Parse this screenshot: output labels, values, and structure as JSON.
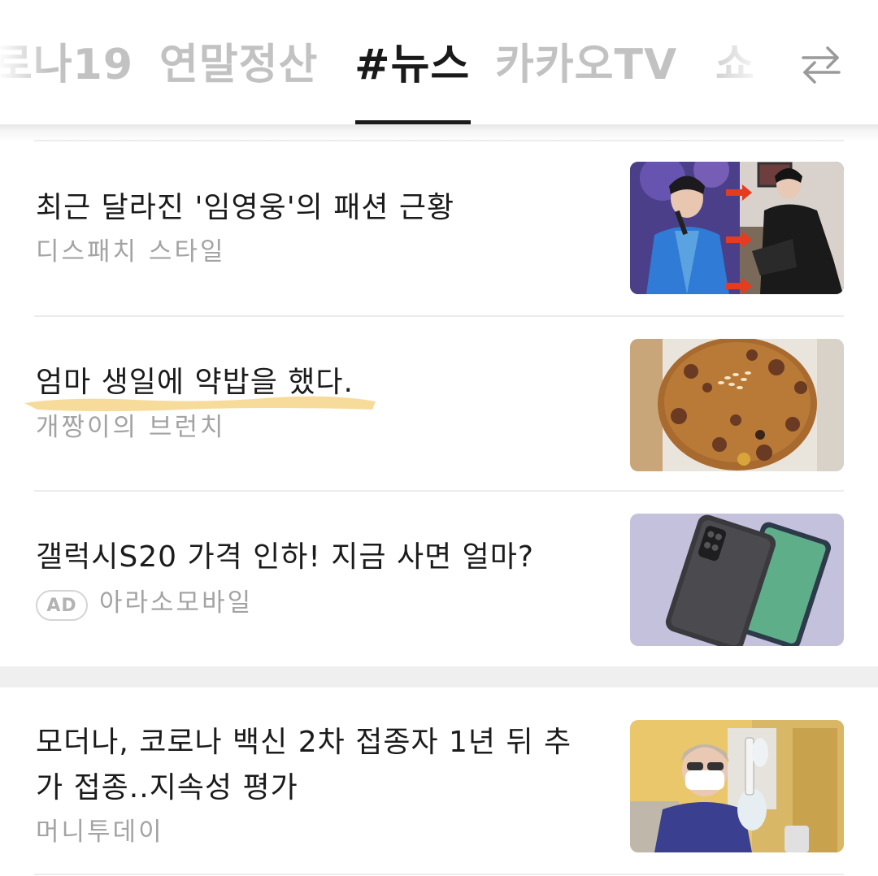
{
  "tabs": [
    {
      "label": "로나19",
      "active": false
    },
    {
      "label": "연말정산",
      "active": false
    },
    {
      "label": "#뉴스",
      "active": true
    },
    {
      "label": "카카오TV",
      "active": false
    },
    {
      "label": "쇼",
      "active": false
    }
  ],
  "swap_icon": "swap-arrows-icon",
  "news": [
    {
      "title": "최근 달라진 '임영웅'의 패션 근황",
      "source": "디스패치 스타일"
    },
    {
      "title": "엄마 생일에 약밥을 했다.",
      "source": "개짱이의 브런치",
      "highlighted": true
    },
    {
      "title": "갤럭시S20 가격 인하! 지금 사면 얼마?",
      "source": "아라소모바일",
      "ad_label": "AD"
    },
    {
      "title_line1": "모더나, 코로나 백신 2차 접종자 1년 뒤 추",
      "title_line2": "가 접종..지속성 평가",
      "source": "머니투데이"
    }
  ],
  "colors": {
    "active_tab": "#1a1a1a",
    "inactive_tab": "#c2c2c2",
    "source_text": "#a3a3a3",
    "highlight_marker": "#f5d58a"
  }
}
